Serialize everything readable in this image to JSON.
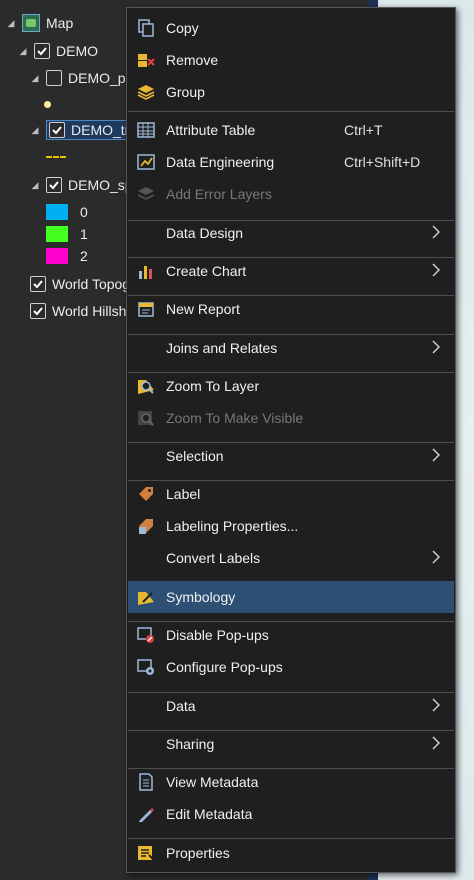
{
  "colors": {
    "menu_bg": "#1f1f1f",
    "highlight": "#2c4f73",
    "selection": "#1e3a5e",
    "swatch_0": "#00b0f0",
    "swatch_1": "#44ff22",
    "swatch_2": "#ff00cc"
  },
  "toc": {
    "map_label": "Map",
    "demo_label": "DEMO",
    "layer_points": "DEMO_po",
    "layer_tracks": "DEMO_tra",
    "layer_spr": "DEMO_spr",
    "legend_0": "0",
    "legend_1": "1",
    "legend_2": "2",
    "world_topo": "World Topog",
    "world_hillshade": "World Hillsha"
  },
  "menu": {
    "copy": "Copy",
    "remove": "Remove",
    "group": "Group",
    "attribute_table": "Attribute Table",
    "attribute_table_shortcut": "Ctrl+T",
    "data_engineering": "Data Engineering",
    "data_engineering_shortcut": "Ctrl+Shift+D",
    "add_error_layers": "Add Error Layers",
    "data_design": "Data Design",
    "create_chart": "Create Chart",
    "new_report": "New Report",
    "joins_relates": "Joins and Relates",
    "zoom_to_layer": "Zoom To Layer",
    "zoom_visible": "Zoom To Make Visible",
    "selection": "Selection",
    "label": "Label",
    "labeling_properties": "Labeling Properties...",
    "convert_labels": "Convert Labels",
    "symbology": "Symbology",
    "disable_popups": "Disable Pop-ups",
    "configure_popups": "Configure Pop-ups",
    "data": "Data",
    "sharing": "Sharing",
    "view_metadata": "View Metadata",
    "edit_metadata": "Edit Metadata",
    "properties": "Properties"
  }
}
